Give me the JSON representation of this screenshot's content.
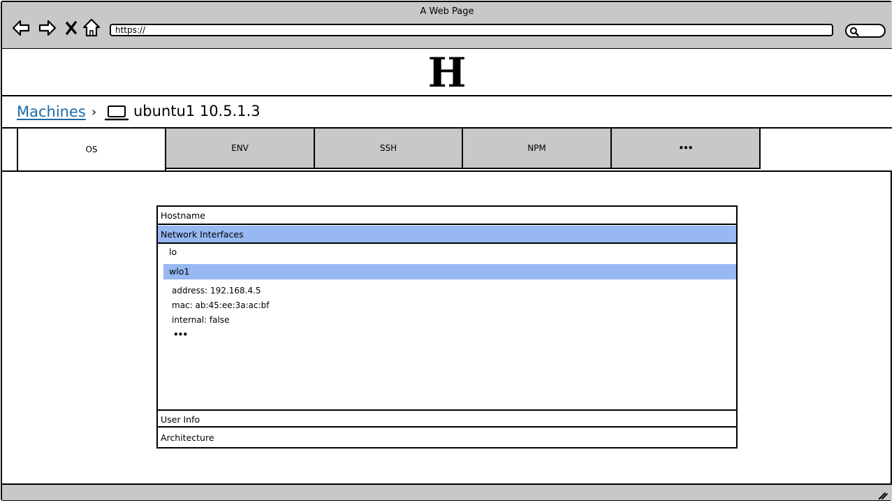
{
  "window": {
    "title": "A Web Page"
  },
  "browser": {
    "url": "https://",
    "icons": [
      "back-arrow-icon",
      "forward-arrow-icon",
      "close-icon",
      "home-icon",
      "search-icon"
    ]
  },
  "banner": {
    "logo_text": "H"
  },
  "breadcrumb": {
    "parent_label": "Machines",
    "separator": "›",
    "current_icon": "laptop-icon",
    "current_label": "ubuntu1 10.5.1.3"
  },
  "tabs": [
    {
      "label": "OS",
      "active": true
    },
    {
      "label": "ENV",
      "active": false
    },
    {
      "label": "SSH",
      "active": false
    },
    {
      "label": "NPM",
      "active": false
    },
    {
      "label": "•••",
      "active": false
    }
  ],
  "accordion": {
    "hostname_label": "Hostname",
    "network_label": "Network Interfaces",
    "interfaces": [
      {
        "name": "lo",
        "selected": false
      },
      {
        "name": "wlo1",
        "selected": true
      }
    ],
    "details": {
      "address": "address: 192.168.4.5",
      "mac": "mac: ab:45:ee:3a:ac:bf",
      "internal": "internal: false",
      "more": "•••"
    },
    "user_info_label": "User Info",
    "architecture_label": "Architecture"
  },
  "colors": {
    "chrome": "#c8c8c8",
    "selection": "#97b8f2",
    "link": "#1a6aa8"
  }
}
